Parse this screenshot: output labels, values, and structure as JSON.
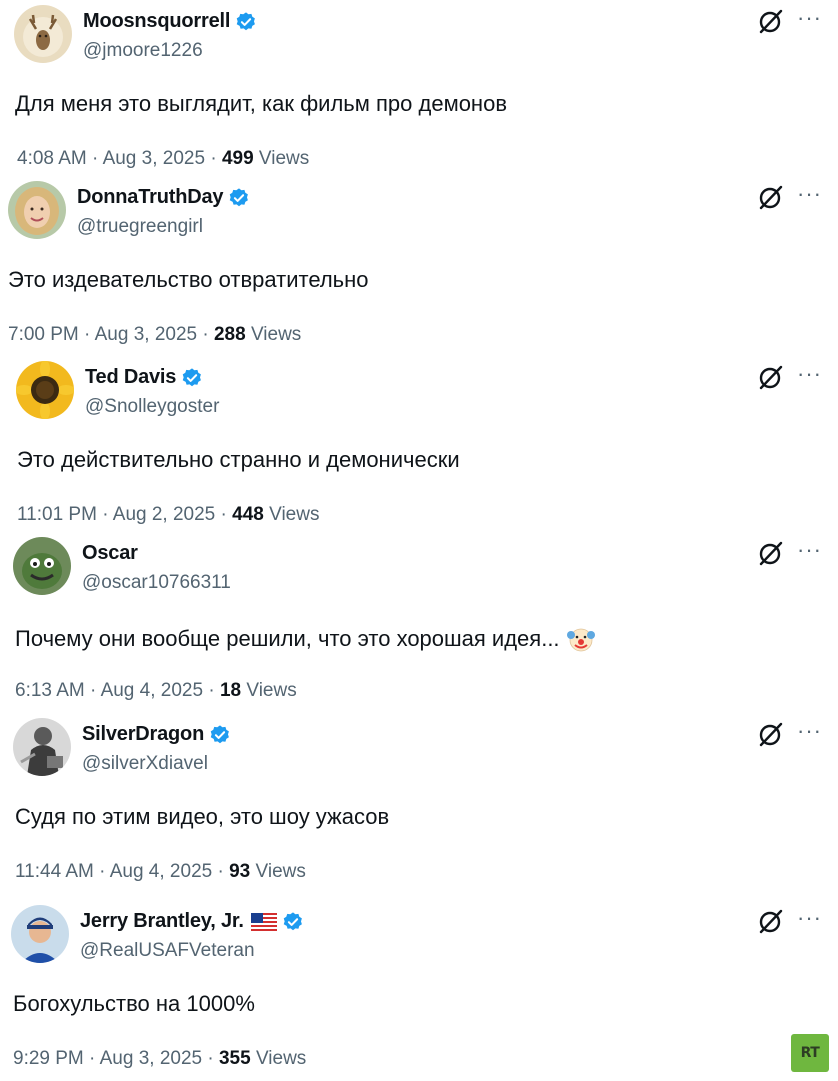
{
  "tweets": [
    {
      "display_name": "Moosnsquorrell",
      "handle": "@jmoore1226",
      "text": "Для меня это выглядит, как фильм про демонов",
      "time": "4:08 AM",
      "date": "Aug 3, 2025",
      "views": "499",
      "views_label": "Views",
      "verified": true
    },
    {
      "display_name": "DonnaTruthDay",
      "handle": "@truegreengirl",
      "text": "Это издевательство отвратительно",
      "time": "7:00 PM",
      "date": "Aug 3, 2025",
      "views": "288",
      "views_label": "Views",
      "verified": true
    },
    {
      "display_name": "Ted Davis",
      "handle": "@Snolleygoster",
      "text": "Это действительно странно и демонически",
      "time": "11:01 PM",
      "date": "Aug 2, 2025",
      "views": "448",
      "views_label": "Views",
      "verified": true
    },
    {
      "display_name": "Oscar",
      "handle": "@oscar10766311",
      "text": "Почему они вообще решили, что это хорошая идея...",
      "time": "6:13 AM",
      "date": "Aug 4, 2025",
      "views": "18",
      "views_label": "Views",
      "verified": false,
      "emoji": "clown-face-icon"
    },
    {
      "display_name": "SilverDragon",
      "handle": "@silverXdiavel",
      "text": "Судя по этим видео, это шоу ужасов",
      "time": "11:44 AM",
      "date": "Aug 4, 2025",
      "views": "93",
      "views_label": "Views",
      "verified": true
    },
    {
      "display_name": "Jerry Brantley, Jr.",
      "handle": "@RealUSAFVeteran",
      "text": "Богохульство на 1000%",
      "time": "9:29 PM",
      "date": "Aug 3, 2025",
      "views": "355",
      "views_label": "Views",
      "verified": true,
      "flag": "us-flag-icon"
    }
  ],
  "separator": "·",
  "more_glyph": "···",
  "watermark": "RT",
  "colors": {
    "text": "#0f1419",
    "secondary": "#536471",
    "verified_blue": "#1d9bf0",
    "rt_green": "#6fb73f"
  }
}
